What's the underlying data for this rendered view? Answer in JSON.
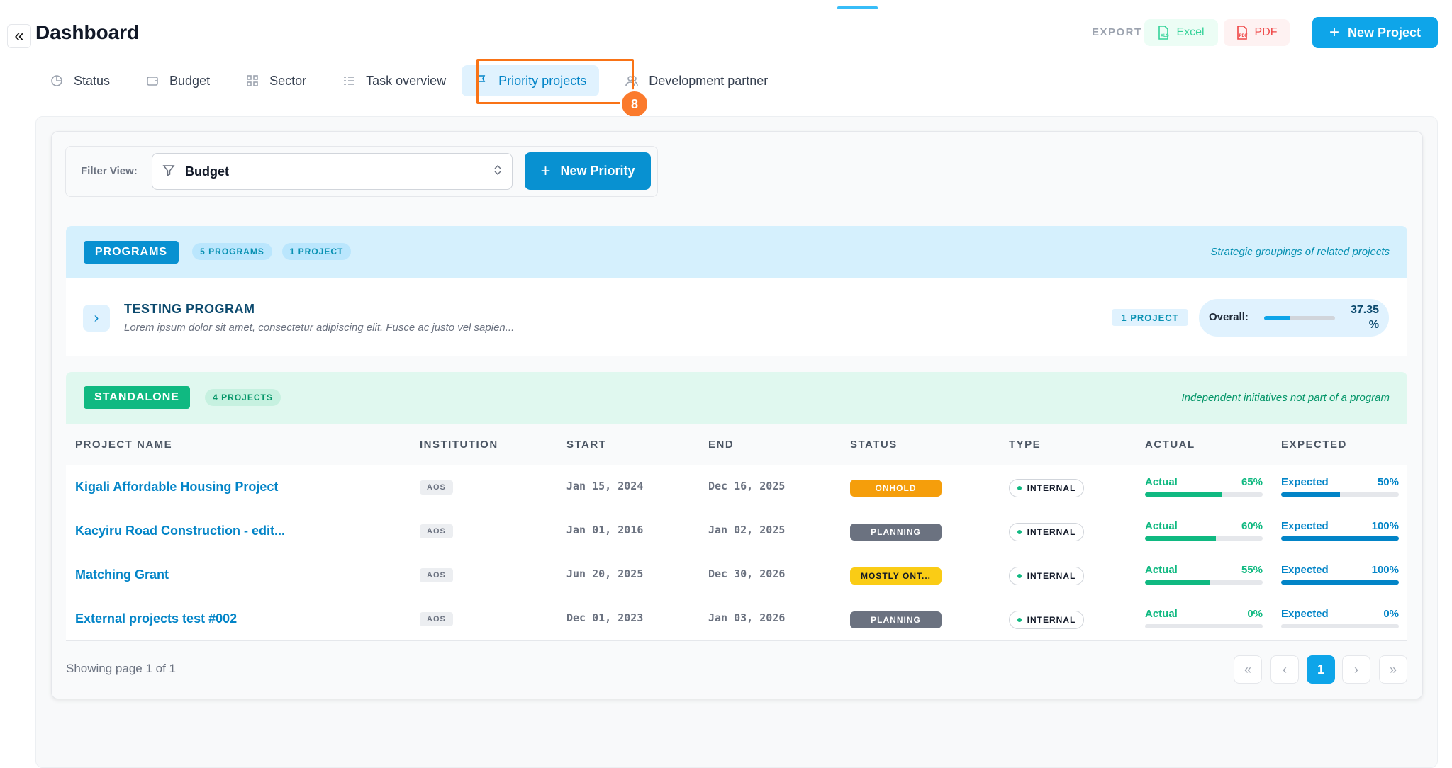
{
  "header": {
    "title": "Dashboard",
    "collapse_icon": "double-chevron-left-icon",
    "export_label": "EXPORT",
    "excel_label": "Excel",
    "pdf_label": "PDF",
    "new_project_label": "New Project"
  },
  "tabs": [
    {
      "label": "Status",
      "icon": "pie-chart-icon"
    },
    {
      "label": "Budget",
      "icon": "wallet-icon"
    },
    {
      "label": "Sector",
      "icon": "grid-icon"
    },
    {
      "label": "Task overview",
      "icon": "list-icon"
    },
    {
      "label": "Priority projects",
      "icon": "flag-icon",
      "active": true
    },
    {
      "label": "Development partner",
      "icon": "users-icon"
    }
  ],
  "annotation": {
    "badge": "8",
    "color": "#f97316"
  },
  "filter": {
    "label": "Filter View:",
    "selected": "Budget",
    "new_priority_label": "New Priority"
  },
  "programs": {
    "tag": "PROGRAMS",
    "count_programs": "5 PROGRAMS",
    "count_projects": "1 PROJECT",
    "note": "Strategic groupings of related projects",
    "item": {
      "title": "TESTING PROGRAM",
      "description": "Lorem ipsum dolor sit amet, consectetur adipiscing elit. Fusce ac justo vel sapien...",
      "project_count": "1 PROJECT",
      "overall_label": "Overall:",
      "overall_value_line1": "37.35",
      "overall_value_line2": "%",
      "overall_percent": 37.35
    }
  },
  "standalone": {
    "tag": "STANDALONE",
    "count_projects": "4 PROJECTS",
    "note": "Independent initiatives not part of a program"
  },
  "table": {
    "headers": {
      "name": "PROJECT NAME",
      "institution": "INSTITUTION",
      "start": "START",
      "end": "END",
      "status": "STATUS",
      "type": "TYPE",
      "actual": "ACTUAL",
      "expected": "EXPECTED"
    },
    "rows": [
      {
        "name": "Kigali Affordable Housing Project",
        "institution": "AOS",
        "start": "Jan 15, 2024",
        "end": "Dec 16, 2025",
        "status": "ONHOLD",
        "status_color": "#f59e0b",
        "type": "INTERNAL",
        "actual_label": "Actual",
        "actual": "65%",
        "actual_pct": 65,
        "expected_label": "Expected",
        "expected": "50%",
        "expected_pct": 50
      },
      {
        "name": "Kacyiru Road Construction - edit...",
        "institution": "AOS",
        "start": "Jan 01, 2016",
        "end": "Jan 02, 2025",
        "status": "PLANNING",
        "status_color": "#6b7280",
        "type": "INTERNAL",
        "actual_label": "Actual",
        "actual": "60%",
        "actual_pct": 60,
        "expected_label": "Expected",
        "expected": "100%",
        "expected_pct": 100
      },
      {
        "name": "Matching Grant",
        "institution": "AOS",
        "start": "Jun 20, 2025",
        "end": "Dec 30, 2026",
        "status": "MOSTLY ONT...",
        "status_color": "#facc15",
        "type": "INTERNAL",
        "actual_label": "Actual",
        "actual": "55%",
        "actual_pct": 55,
        "expected_label": "Expected",
        "expected": "100%",
        "expected_pct": 100
      },
      {
        "name": "External projects test #002",
        "institution": "AOS",
        "start": "Dec 01, 2023",
        "end": "Jan 03, 2026",
        "status": "PLANNING",
        "status_color": "#6b7280",
        "type": "INTERNAL",
        "actual_label": "Actual",
        "actual": "0%",
        "actual_pct": 0,
        "expected_label": "Expected",
        "expected": "0%",
        "expected_pct": 0
      }
    ]
  },
  "pagination": {
    "summary": "Showing page 1 of 1",
    "current": "1",
    "first_icon": "double-chevron-left-icon",
    "prev_icon": "chevron-left-icon",
    "next_icon": "chevron-right-icon",
    "last_icon": "double-chevron-right-icon"
  },
  "colors": {
    "accent": "#0ea5e9",
    "programs_tag": "#0891d1",
    "standalone_tag": "#10b981",
    "actual_bar": "#10b981",
    "expected_bar": "#0284c7"
  }
}
